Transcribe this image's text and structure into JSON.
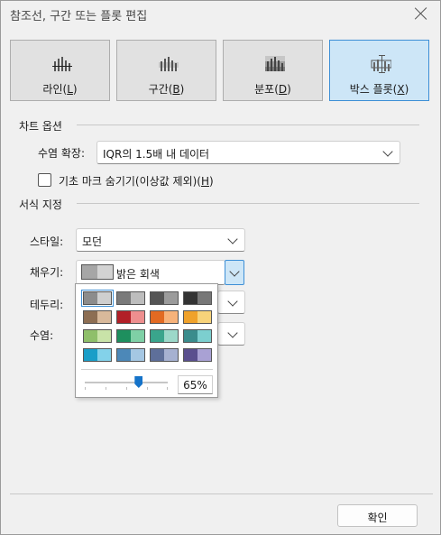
{
  "window": {
    "title": "참조선, 구간 또는 플롯 편집"
  },
  "mark_types": [
    {
      "label": "라인(",
      "key": "L",
      "suffix": ")",
      "icon": "reference-line-icon",
      "selected": false
    },
    {
      "label": "구간(",
      "key": "B",
      "suffix": ")",
      "icon": "band-icon",
      "selected": false
    },
    {
      "label": "분포(",
      "key": "D",
      "suffix": ")",
      "icon": "distribution-icon",
      "selected": false
    },
    {
      "label": "박스 플롯(",
      "key": "X",
      "suffix": ")",
      "icon": "box-plot-icon",
      "selected": true
    }
  ],
  "chart_options": {
    "heading": "차트 옵션",
    "whisker_label": "수염 확장:",
    "whisker_value": "IQR의 1.5배 내 데이터",
    "hide_marks_label": "기초 마크 숨기기(이상값 제외)(",
    "hide_marks_key": "H",
    "hide_marks_suffix": ")",
    "hide_marks_checked": false
  },
  "formatting": {
    "heading": "서식 지정",
    "style_label": "스타일:",
    "style_value": "모던",
    "fill_label": "채우기:",
    "fill_value": "밝은 회색",
    "fill_colors": [
      "#a6a6a6",
      "#d3d3d3"
    ],
    "border_label": "테두리:",
    "whisker_label": "수염:"
  },
  "palette": {
    "rows": [
      [
        [
          "#8c8c8c",
          "#cfcfcf"
        ],
        [
          "#7a7a7a",
          "#bdbdbd"
        ],
        [
          "#555555",
          "#9b9b9b"
        ],
        [
          "#333333",
          "#777777"
        ]
      ],
      [
        [
          "#8d6e53",
          "#d8b99b"
        ],
        [
          "#b22028",
          "#ee8f8f"
        ],
        [
          "#e26a22",
          "#f7b27a"
        ],
        [
          "#f0a22b",
          "#f8d37a"
        ]
      ],
      [
        [
          "#8fbf6a",
          "#c9e3a8"
        ],
        [
          "#1e8f5e",
          "#7fd0a6"
        ],
        [
          "#3aa58c",
          "#9cd8c9"
        ],
        [
          "#3a8c8c",
          "#7ccfcf"
        ]
      ],
      [
        [
          "#1a9ec8",
          "#83d2ea"
        ],
        [
          "#4c88b8",
          "#a5c7e3"
        ],
        [
          "#5e6f9a",
          "#a6b1d1"
        ],
        [
          "#5a4f8e",
          "#a9a1d4"
        ]
      ]
    ],
    "selected": [
      0,
      0
    ],
    "opacity_value": 65,
    "opacity_text": "65%"
  },
  "footer": {
    "ok_label": "확인"
  }
}
